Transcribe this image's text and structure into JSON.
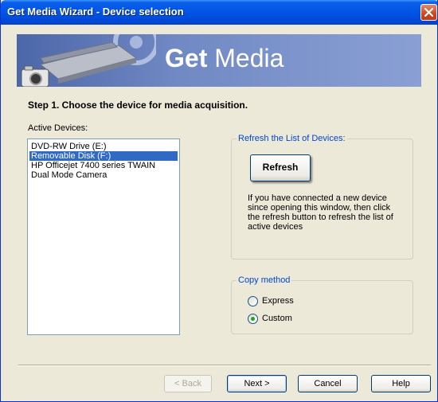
{
  "window": {
    "title": "Get Media Wizard - Device selection"
  },
  "banner": {
    "heading_bold": "Get",
    "heading_rest": " Media"
  },
  "step": {
    "title": "Step 1. Choose the device for media acquisition."
  },
  "devices": {
    "label": "Active Devices:",
    "items": [
      {
        "label": "DVD-RW Drive (E:)",
        "selected": false
      },
      {
        "label": "Removable Disk (F:)",
        "selected": true
      },
      {
        "label": "HP Officejet 7400 series TWAIN",
        "selected": false
      },
      {
        "label": "Dual Mode Camera",
        "selected": false
      }
    ]
  },
  "refresh": {
    "legend": "Refresh the List of Devices:",
    "button_label": "Refresh",
    "help_text": "If you have connected a new device since opening this window, then click the refresh button to refresh the list of active devices"
  },
  "copy_method": {
    "legend": "Copy method",
    "options": [
      {
        "label": "Express",
        "checked": false
      },
      {
        "label": "Custom",
        "checked": true
      }
    ]
  },
  "footer": {
    "back_label": "< Back",
    "next_label": "Next >",
    "cancel_label": "Cancel",
    "help_label": "Help"
  },
  "colors": {
    "title_bar": "#0055e5",
    "selection": "#316ac5",
    "legend": "#0046d5",
    "radio_check": "#21a121",
    "dialog_bg": "#ece9d8"
  },
  "icons": {
    "close": "close-icon",
    "banner_art": "scanner-camera-icon"
  }
}
